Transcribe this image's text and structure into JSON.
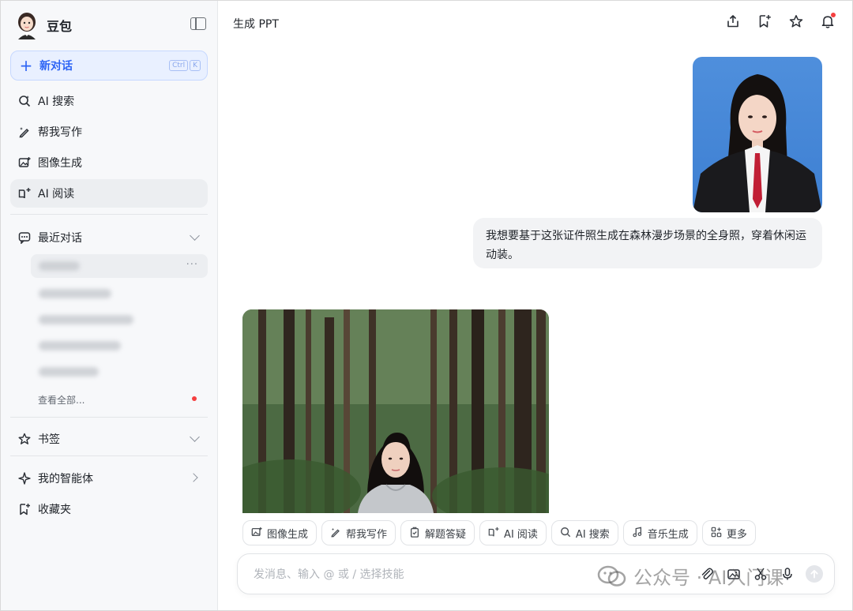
{
  "sidebar": {
    "brand": "豆包",
    "new_chat": {
      "label": "新对话",
      "shortcut": [
        "Ctrl",
        "K"
      ]
    },
    "nav": [
      {
        "label": "AI 搜索",
        "icon": "ai-search-icon"
      },
      {
        "label": "帮我写作",
        "icon": "pen-sparkle-icon"
      },
      {
        "label": "图像生成",
        "icon": "image-add-icon"
      },
      {
        "label": "AI 阅读",
        "icon": "book-sparkle-icon"
      }
    ],
    "recent": {
      "label": "最近对话",
      "see_all": "查看全部..."
    },
    "bookmarks": "书签",
    "agents": "我的智能体",
    "favorites": "收藏夹"
  },
  "main": {
    "title": "生成 PPT",
    "user_message": "我想要基于这张证件照生成在森林漫步场景的全身照，穿着休闲运动装。",
    "skills": [
      "图像生成",
      "帮我写作",
      "解题答疑",
      "AI 阅读",
      "AI 搜索",
      "音乐生成",
      "更多"
    ],
    "composer": {
      "placeholder": "发消息、输入 @ 或 / 选择技能"
    },
    "watermark": "公众号 · AI入门课"
  },
  "colors": {
    "accent": "#2d64f5",
    "notification": "#f53f3f",
    "sidebar_bg": "#f7f8fa"
  }
}
